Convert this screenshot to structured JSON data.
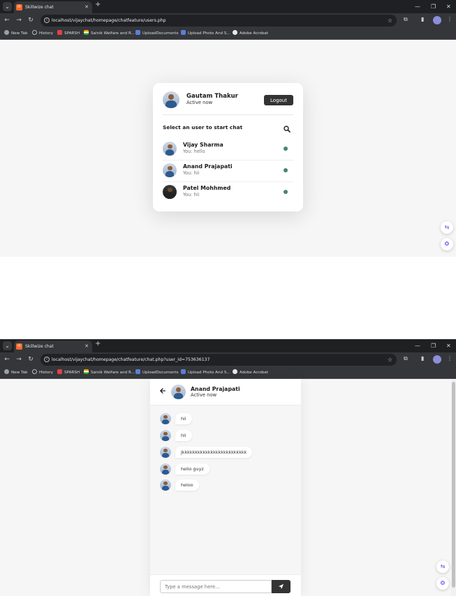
{
  "browser1": {
    "tab_title": "Skillwize chat",
    "url": "localhost/vijaychat/homepage/chatfeature/users.php"
  },
  "browser2": {
    "tab_title": "Skillwize chat",
    "url": "localhost/vijaychat/homepage/chatfeature/chat.php?user_id=753636137"
  },
  "bookmarks": [
    {
      "label": "New Tab"
    },
    {
      "label": "History"
    },
    {
      "label": "SPARSH"
    },
    {
      "label": "Sainik Welfare and R..."
    },
    {
      "label": "UploadDocuments"
    },
    {
      "label": "Upload Photo And S..."
    },
    {
      "label": "Adobe Acrobat"
    }
  ],
  "users_page": {
    "current_user": {
      "name": "Gautam Thakur",
      "status": "Active now"
    },
    "logout_label": "Logout",
    "search_label": "Select an user to start chat",
    "users": [
      {
        "name": "Vijay Sharma",
        "last_message": "You: hello"
      },
      {
        "name": "Anand Prajapati",
        "last_message": "You: hii"
      },
      {
        "name": "Patel Mohhmed",
        "last_message": "You: hii"
      }
    ]
  },
  "chat_page": {
    "partner": {
      "name": "Anand Prajapati",
      "status": "Active now"
    },
    "messages": [
      {
        "text": "hii"
      },
      {
        "text": "hii"
      },
      {
        "text": "jkkkkkkkkkkkkkkkkkkkkkkkkk"
      },
      {
        "text": "hello guyz"
      },
      {
        "text": "heloo"
      }
    ],
    "input_placeholder": "Type a message here..."
  },
  "colors": {
    "online_dot": "#468669",
    "button_dark": "#333333",
    "browser_frame": "#35363a"
  }
}
